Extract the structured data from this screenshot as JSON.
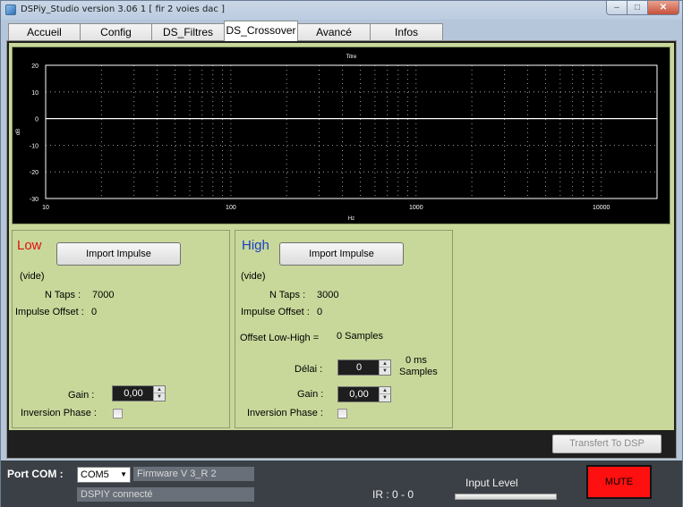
{
  "window": {
    "title": "DSPiy_Studio version 3.06 1 [ fir 2 voies dac ]",
    "buttons": {
      "minimize": "–",
      "maximize": "□",
      "close": "✕"
    }
  },
  "tabs": [
    {
      "label": "Accueil"
    },
    {
      "label": "Config"
    },
    {
      "label": "DS_Filtres"
    },
    {
      "label": "DS_Crossover",
      "active": true
    },
    {
      "label": "Avancé"
    },
    {
      "label": "Infos"
    }
  ],
  "chart": {
    "title": "Titre",
    "xlabel": "Hz",
    "ylabel": "dB",
    "y_ticks": [
      "20",
      "10",
      "0",
      "-10",
      "-20",
      "-30"
    ],
    "x_ticks": [
      "10",
      "100",
      "1000",
      "10000"
    ],
    "colors": {
      "background": "#000000",
      "grid": "#ffffff",
      "curve": "#ffffff",
      "text": "#ffffff"
    }
  },
  "chart_data": {
    "type": "line",
    "title": "Titre",
    "xlabel": "Hz",
    "ylabel": "dB",
    "xscale": "log",
    "xlim": [
      10,
      20000
    ],
    "ylim": [
      -30,
      20
    ],
    "grid": true,
    "series": [
      {
        "x": [
          10,
          20000
        ],
        "values": [
          0,
          0
        ]
      }
    ]
  },
  "low": {
    "title": "Low",
    "import_label": "Import Impulse",
    "file": "(vide)",
    "ntaps_label": "N Taps :",
    "ntaps": "7000",
    "offset_label": "Impulse Offset :",
    "offset": "0",
    "gain_label": "Gain :",
    "gain": "0,00",
    "inversion_label": "Inversion Phase :",
    "inversion_checked": false
  },
  "high": {
    "title": "High",
    "import_label": "Import Impulse",
    "file": "(vide)",
    "ntaps_label": "N Taps :",
    "ntaps": "3000",
    "offset_label": "Impulse Offset :",
    "offset": "0",
    "offset_lowhigh_label": "Offset Low-High =",
    "offset_lowhigh": "0 Samples",
    "delai_label": "Délai :",
    "delai": "0",
    "delai_ms": "0 ms",
    "delai_samples": "Samples",
    "gain_label": "Gain :",
    "gain": "0,00",
    "inversion_label": "Inversion Phase :",
    "inversion_checked": false
  },
  "transfer_label": "Transfert To DSP",
  "status": {
    "port_label": "Port COM :",
    "port_value": "COM5",
    "firmware": "Firmware V 3_R 2",
    "connection": "DSPIY connecté",
    "ir": "IR : 0 - 0",
    "input_level_label": "Input Level",
    "input_level": 0,
    "mute_label": "MUTE",
    "mute_color": "#ff1010"
  }
}
